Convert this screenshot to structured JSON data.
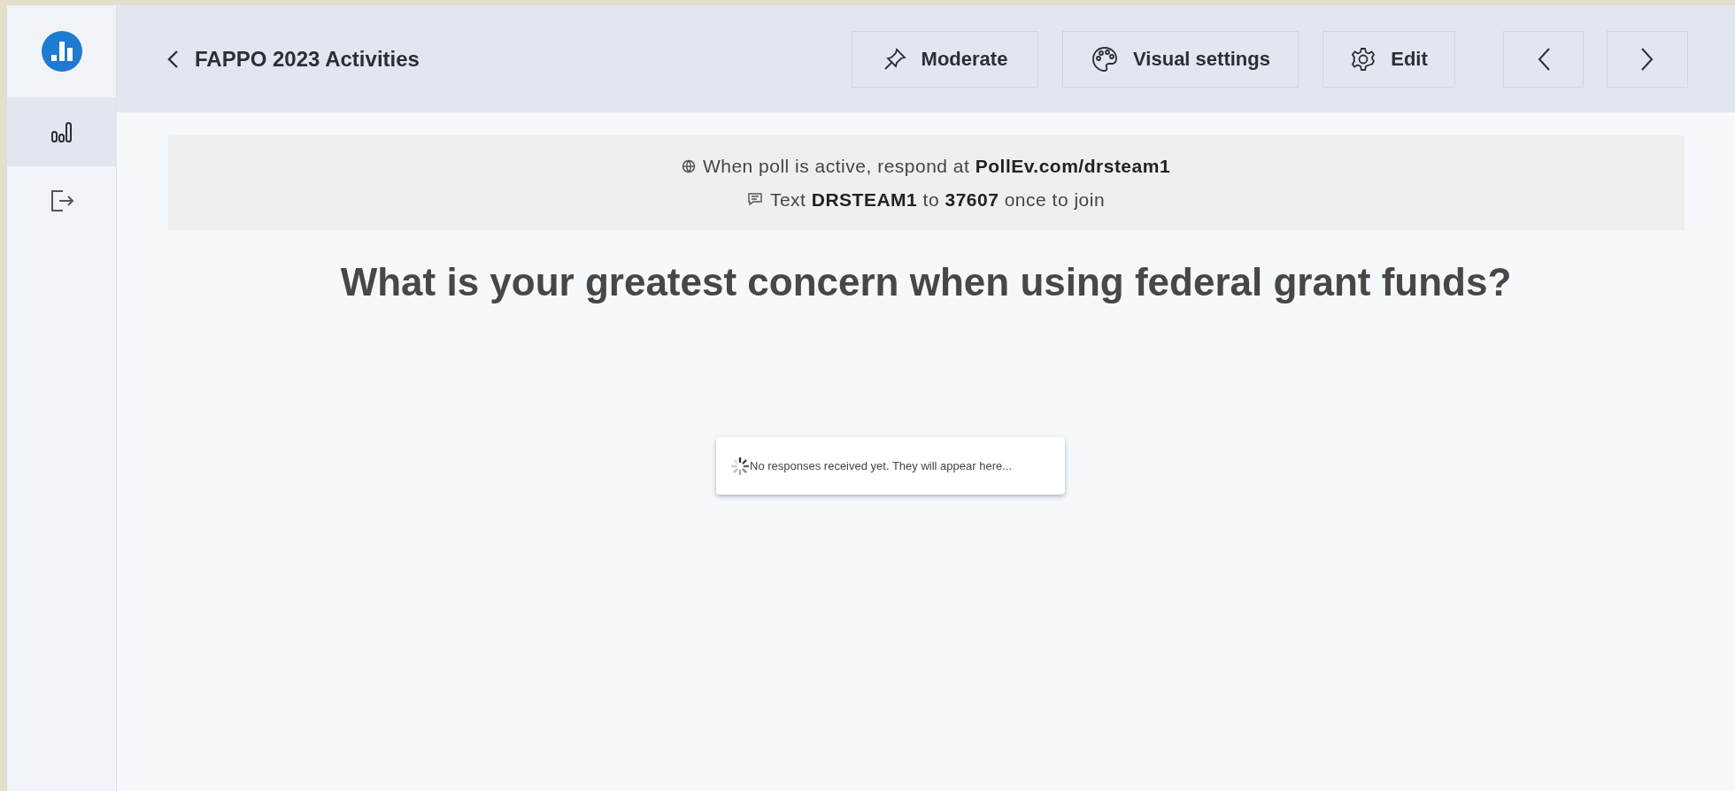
{
  "sidebar": {
    "items": [
      {
        "kind": "results",
        "selected": true
      },
      {
        "kind": "logout",
        "selected": false
      }
    ]
  },
  "header": {
    "back_title": "FAPPO 2023 Activities",
    "buttons": [
      {
        "kind": "moderate",
        "label": "Moderate"
      },
      {
        "kind": "visual",
        "label": "Visual settings"
      },
      {
        "kind": "edit",
        "label": "Edit"
      },
      {
        "kind": "prev"
      },
      {
        "kind": "next"
      }
    ]
  },
  "banner": [
    {
      "kind": "web",
      "text": "When poll is active, respond at **PollEv.com/drsteam1**"
    },
    {
      "kind": "sms",
      "text": "Text **DRSTEAM1** to **37607** once to join"
    }
  ],
  "question": "What is your greatest concern when using federal grant funds?",
  "empty_message": "No responses received yet. They will appear here..."
}
